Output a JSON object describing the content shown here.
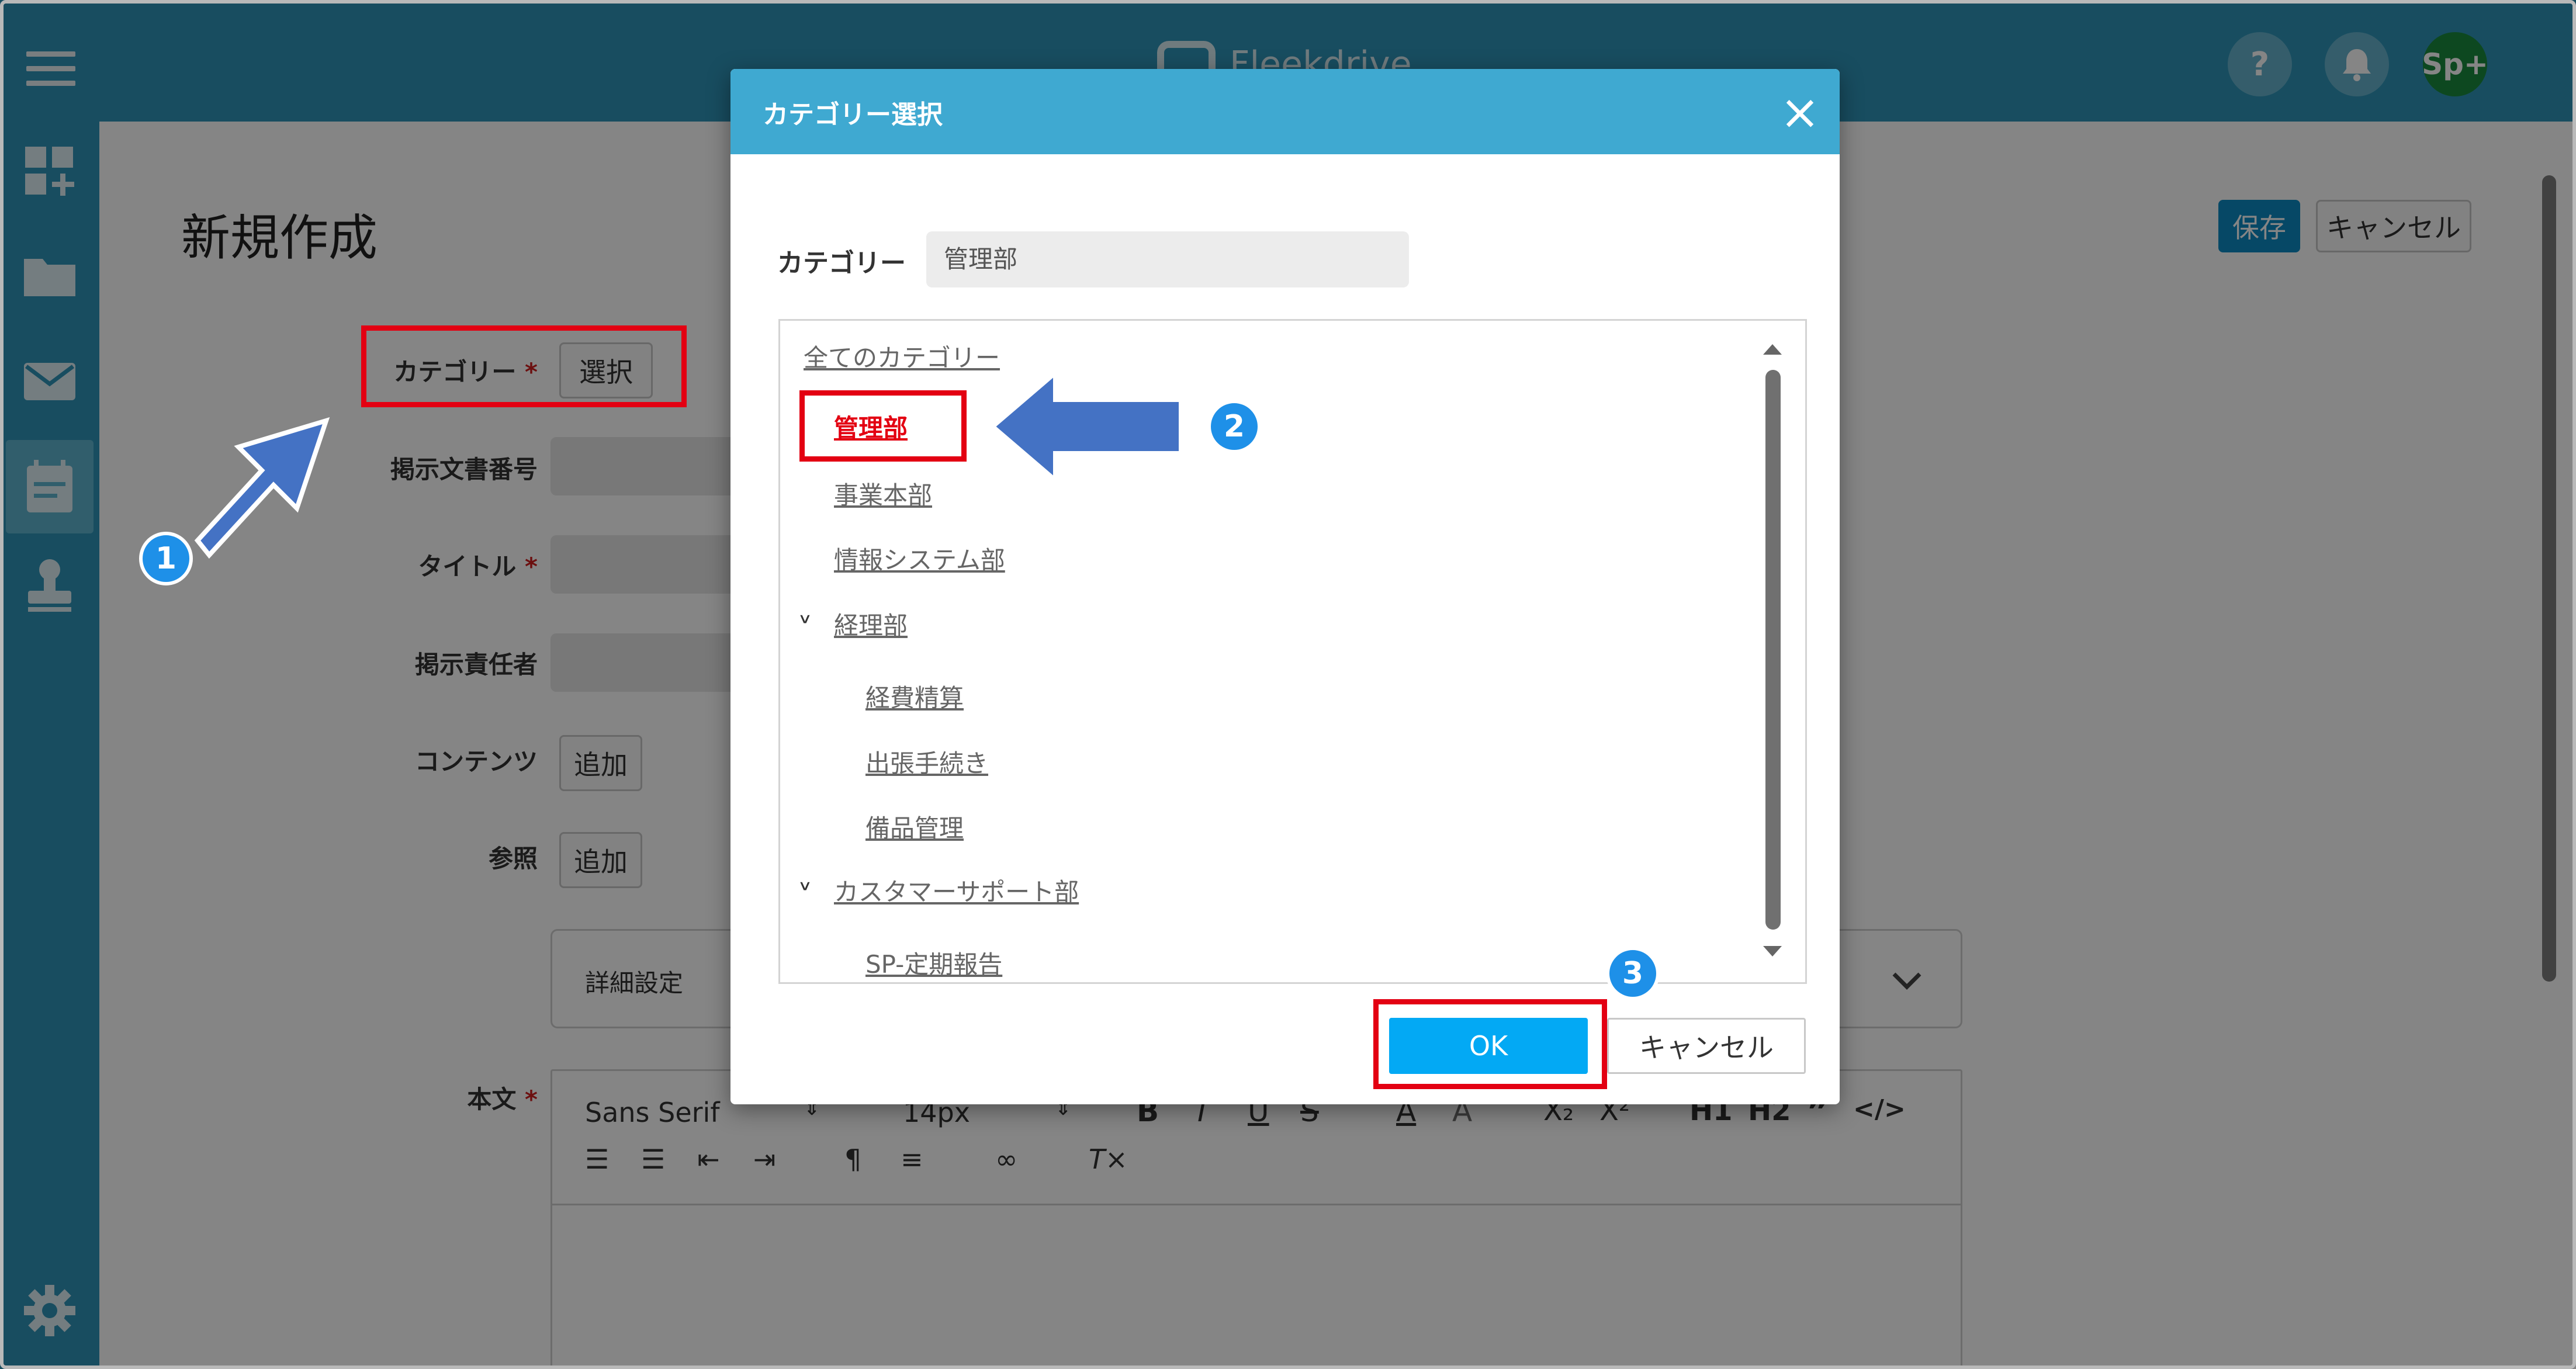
{
  "app": {
    "brand": "Fleekdrive",
    "avatar_label": "Sp+",
    "help_label": "?"
  },
  "sidebar": {
    "items": [
      {
        "icon": "dashboard-add-icon"
      },
      {
        "icon": "folder-icon"
      },
      {
        "icon": "mail-icon"
      },
      {
        "icon": "calendar-icon"
      },
      {
        "icon": "stamp-icon"
      },
      {
        "icon": "gear-icon"
      }
    ]
  },
  "page": {
    "title": "新規作成",
    "save_label": "保存",
    "cancel_label": "キャンセル",
    "fields": {
      "category": "カテゴリー",
      "category_button": "選択",
      "doc_number": "掲示文書番号",
      "title": "タイトル",
      "owner": "掲示責任者",
      "contents": "コンテンツ",
      "contents_button": "追加",
      "reference": "参照",
      "reference_button": "追加",
      "body": "本文",
      "required_mark": "*"
    },
    "detail_settings": "詳細設定",
    "editor": {
      "font": "Sans Serif",
      "size": "14px"
    }
  },
  "modal": {
    "title": "カテゴリー選択",
    "category_label": "カテゴリー",
    "category_value": "管理部",
    "tree": [
      {
        "label": "全てのカテゴリー",
        "level": 0
      },
      {
        "label": "管理部",
        "level": 1,
        "selected": true
      },
      {
        "label": "事業本部",
        "level": 1
      },
      {
        "label": "情報システム部",
        "level": 1
      },
      {
        "label": "経理部",
        "level": 1,
        "expanded": true
      },
      {
        "label": "経費精算",
        "level": 2
      },
      {
        "label": "出張手続き",
        "level": 2
      },
      {
        "label": "備品管理",
        "level": 2
      },
      {
        "label": "カスタマーサポート部",
        "level": 1,
        "expanded": true
      },
      {
        "label": "SP-定期報告",
        "level": 2
      }
    ],
    "ok_label": "OK",
    "cancel_label": "キャンセル"
  },
  "annotations": {
    "step1": "1",
    "step2": "2",
    "step3": "3"
  },
  "colors": {
    "header": "#2e95b8",
    "modal_header": "#3fa9d1",
    "primary": "#0d8ac4",
    "ok": "#03a9f4",
    "highlight": "#e30012",
    "selected_text": "#e30012",
    "badge": "#1e90e8",
    "arrow": "#4472c4"
  }
}
